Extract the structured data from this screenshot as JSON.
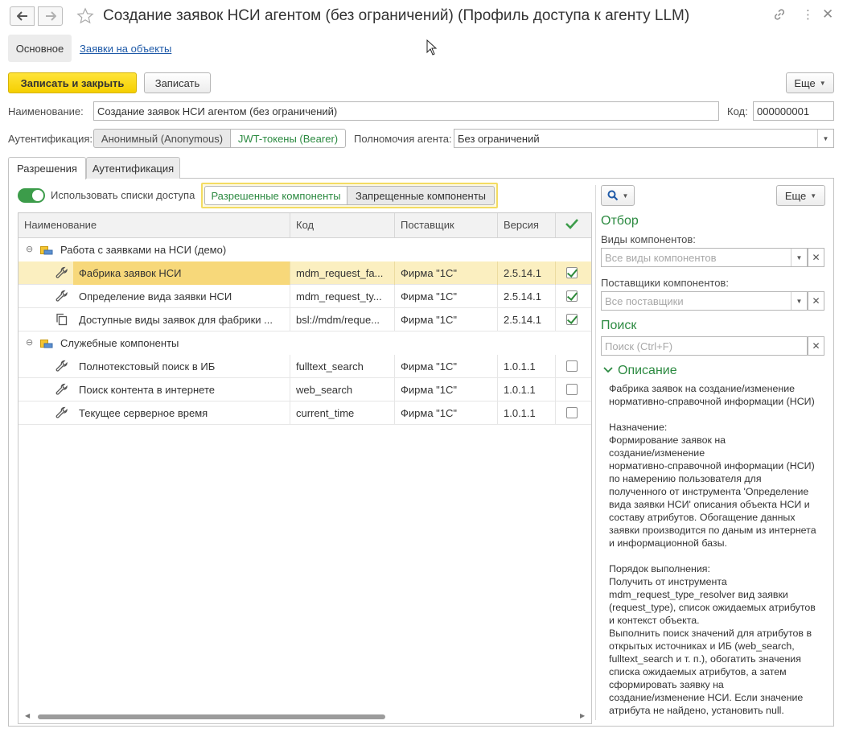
{
  "window": {
    "title": "Создание заявок НСИ агентом (без ограничений) (Профиль доступа к агенту LLM)"
  },
  "form_tabs": {
    "main": "Основное",
    "link": "Заявки на объекты"
  },
  "toolbar": {
    "save_close": "Записать и закрыть",
    "save": "Записать",
    "more": "Еще"
  },
  "fields": {
    "name_label": "Наименование:",
    "name_value": "Создание заявок НСИ агентом (без ограничений)",
    "code_label": "Код:",
    "code_value": "000000001",
    "auth_label": "Аутентификация:",
    "auth_option_anon": "Анонимный (Anonymous)",
    "auth_option_jwt": "JWT-токены (Bearer)",
    "powers_label": "Полномочия агента:",
    "powers_value": "Без ограничений"
  },
  "page_tabs": [
    "Разрешения",
    "Аутентификация"
  ],
  "permissions": {
    "use_lists_label": "Использовать списки доступа",
    "allowed_label": "Разрешенные компоненты",
    "denied_label": "Запрещенные компоненты"
  },
  "table": {
    "columns": [
      "Наименование",
      "Код",
      "Поставщик",
      "Версия"
    ],
    "groups": [
      {
        "name": "Работа с заявками на НСИ (демо)",
        "rows": [
          {
            "name": "Фабрика заявок НСИ",
            "code": "mdm_request_fa...",
            "supplier": "Фирма \"1С\"",
            "version": "2.5.14.1",
            "checked": true,
            "icon": "wrench-icon"
          },
          {
            "name": "Определение вида заявки НСИ",
            "code": "mdm_request_ty...",
            "supplier": "Фирма \"1С\"",
            "version": "2.5.14.1",
            "checked": true,
            "icon": "wrench-icon"
          },
          {
            "name": "Доступные виды заявок для фабрики ...",
            "code": "bsl://mdm/reque...",
            "supplier": "Фирма \"1С\"",
            "version": "2.5.14.1",
            "checked": true,
            "icon": "copy-icon"
          }
        ]
      },
      {
        "name": "Служебные компоненты",
        "rows": [
          {
            "name": "Полнотекстовый поиск в ИБ",
            "code": "fulltext_search",
            "supplier": "Фирма \"1С\"",
            "version": "1.0.1.1",
            "checked": false,
            "icon": "wrench-icon"
          },
          {
            "name": "Поиск контента в интернете",
            "code": "web_search",
            "supplier": "Фирма \"1С\"",
            "version": "1.0.1.1",
            "checked": false,
            "icon": "wrench-icon"
          },
          {
            "name": "Текущее серверное время",
            "code": "current_time",
            "supplier": "Фирма \"1С\"",
            "version": "1.0.1.1",
            "checked": false,
            "icon": "wrench-icon"
          }
        ]
      }
    ]
  },
  "right_panel": {
    "more": "Еще",
    "filter_header": "Отбор",
    "component_types_label": "Виды компонентов:",
    "component_types_placeholder": "Все виды компонентов",
    "suppliers_label": "Поставщики компонентов:",
    "suppliers_placeholder": "Все поставщики",
    "search_header": "Поиск",
    "search_placeholder": "Поиск (Ctrl+F)",
    "description_header": "Описание",
    "description_text": "Фабрика заявок на создание/изменение\nнормативно-справочной информации (НСИ)\n\nНазначение:\nФормирование заявок на\nсоздание/изменение\nнормативно-справочной информации (НСИ)\nпо намерению пользователя для\nполученного от инструмента 'Определение\nвида заявки НСИ' описания объекта НСИ и\nсоставу атрибутов. Обогащение данных\nзаявки производится по даным из интернета\nи информационной базы.\n\nПорядок выполнения:\nПолучить от инструмента\nmdm_request_type_resolver вид заявки\n(request_type), список ожидаемых атрибутов\nи контекст объекта.\nВыполнить поиск значений для атрибутов в\nоткрытых источниках и ИБ (web_search,\nfulltext_search и т. п.), обогатить значения\nсписка ожидаемых атрибутов, а затем\nсформировать заявку на\nсоздание/изменение НСИ. Если значение\nатрибута не найдено, установить null."
  },
  "colors": {
    "accent_green": "#2c8a41",
    "primary_yellow": "#f5cf00",
    "selection": "#fbefc0"
  }
}
